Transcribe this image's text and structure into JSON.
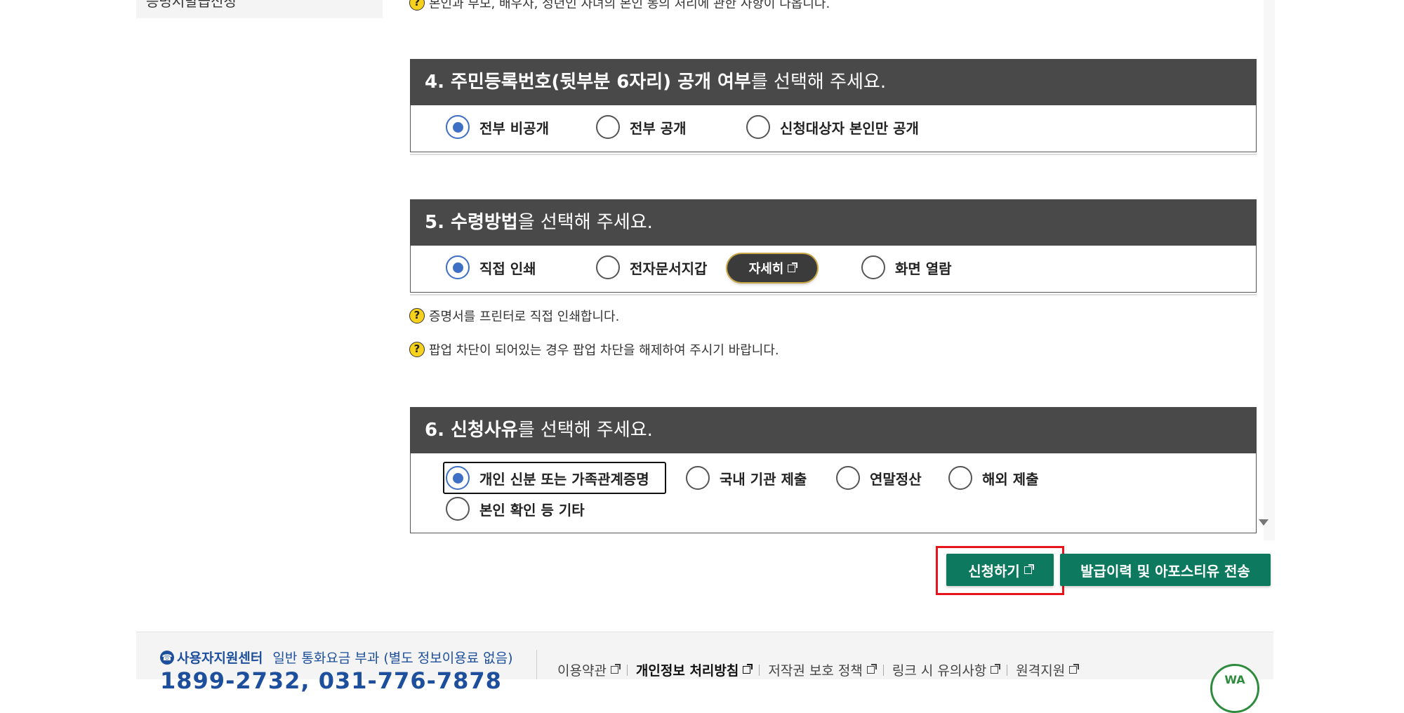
{
  "sidebar": {
    "partial_label": "증명서발급신청"
  },
  "top_help_text": "본인과 부모, 배우자, 성년인 자녀의 본인 동의 처리에 관한 사항이 나옵니다.",
  "section4": {
    "title_bold": "4. 주민등록번호(뒷부분 6자리) 공개 여부",
    "title_rest": "를 선택해 주세요.",
    "options": [
      {
        "label": "전부 비공개",
        "checked": true
      },
      {
        "label": "전부 공개",
        "checked": false
      },
      {
        "label": "신청대상자 본인만 공개",
        "checked": false
      }
    ]
  },
  "section5": {
    "title_bold": "5. 수령방법",
    "title_rest": "을 선택해 주세요.",
    "options": [
      {
        "label": "직접 인쇄",
        "checked": true
      },
      {
        "label": "전자문서지갑",
        "checked": false
      },
      {
        "label": "화면 열람",
        "checked": false
      }
    ],
    "detail_button": "자세히",
    "help": [
      "증명서를 프린터로 직접 인쇄합니다.",
      "팝업 차단이 되어있는 경우 팝업 차단을 해제하여 주시기 바랍니다."
    ]
  },
  "section6": {
    "title_bold": "6. 신청사유",
    "title_rest": "를 선택해 주세요.",
    "options": [
      {
        "label": "개인 신분 또는 가족관계증명",
        "checked": true
      },
      {
        "label": "국내 기관 제출",
        "checked": false
      },
      {
        "label": "연말정산",
        "checked": false
      },
      {
        "label": "해외 제출",
        "checked": false
      },
      {
        "label": "본인 확인 등 기타",
        "checked": false
      }
    ]
  },
  "actions": {
    "apply": "신청하기",
    "history": "발급이력 및 아포스티유 전송"
  },
  "footer": {
    "support_title": "사용자지원센터",
    "support_note": "일반 통화요금 부과 (별도 정보이용료 없음)",
    "phone": "1899-2732, 031-776-7878",
    "links": [
      "이용약관",
      "개인정보 처리방침",
      "저작권 보호 정책",
      "링크 시 유의사항",
      "원격지원"
    ],
    "badge": "WA"
  },
  "colors": {
    "header_bg": "#494949",
    "accent_blue": "#3d6fc4",
    "button_green": "#0d7a5f",
    "highlight_red": "#e8141b",
    "help_yellow": "#f7d21c"
  }
}
